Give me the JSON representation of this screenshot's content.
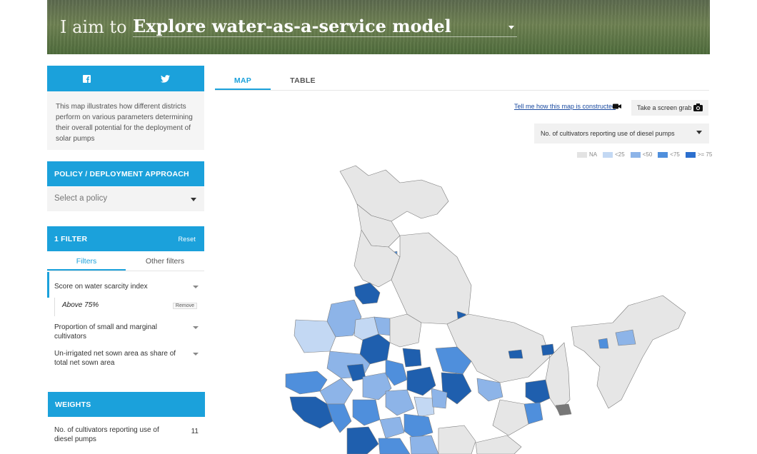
{
  "banner": {
    "lead": "I aim to",
    "goal": "Explore water-as-a-service model"
  },
  "share": {
    "facebook_icon": "facebook-icon",
    "twitter_icon": "twitter-icon"
  },
  "intro": "This map illustrates how different districts perform on various parameters determining their overall potential for the deployment of solar pumps",
  "policy": {
    "title": "POLICY / DEPLOYMENT APPROACH",
    "placeholder": "Select a policy"
  },
  "filter": {
    "title": "1 FILTER",
    "reset": "Reset",
    "tabs": [
      "Filters",
      "Other filters"
    ],
    "items": [
      {
        "label": "Score on water scarcity index",
        "value": "Above 75%",
        "remove": "Remove"
      },
      {
        "label": "Proportion of small and marginal cultivators"
      },
      {
        "label": "Un-irrigated net sown area as share of total net sown area"
      }
    ]
  },
  "weights": {
    "title": "WEIGHTS",
    "items": [
      {
        "label": "No. of cultivators reporting use of diesel pumps",
        "value": "11"
      }
    ]
  },
  "main": {
    "tabs": [
      "MAP",
      "TABLE"
    ],
    "tell_link": "Tell me how this map is constructed",
    "screengrab": "Take a screen grab",
    "parameter": "No. of cultivators reporting use of diesel pumps",
    "legend": [
      {
        "label": "NA",
        "color": "#e3e3e3"
      },
      {
        "label": "<25",
        "color": "#c3d8f3"
      },
      {
        "label": "<50",
        "color": "#8db4e8"
      },
      {
        "label": "<75",
        "color": "#4f8fdc"
      },
      {
        "label": ">= 75",
        "color": "#2b6fce"
      }
    ]
  },
  "colors": {
    "accent": "#1ba1db",
    "na": "#e3e3e3",
    "c1": "#c3d8f3",
    "c2": "#8db4e8",
    "c3": "#4f8fdc",
    "c4": "#1f5fae"
  }
}
